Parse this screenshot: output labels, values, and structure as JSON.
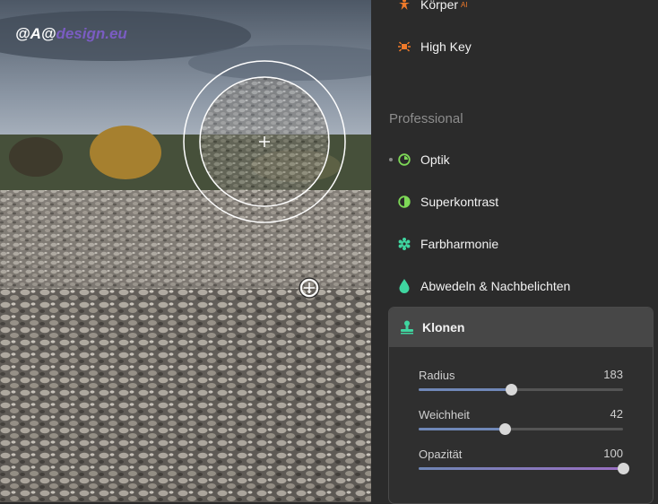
{
  "watermark": {
    "prefix": "@A@",
    "brand": "design.eu"
  },
  "tools_top": [
    {
      "label": "Körper",
      "badge": "AI",
      "icon": "body-icon",
      "color": "#f07a2a"
    },
    {
      "label": "High Key",
      "icon": "high-key-icon",
      "color": "#f07a2a"
    }
  ],
  "section": {
    "title": "Professional"
  },
  "tools_pro": [
    {
      "label": "Optik",
      "icon": "lens-icon",
      "color": "#7ed957"
    },
    {
      "label": "Superkontrast",
      "icon": "contrast-icon",
      "color": "#7ed957"
    },
    {
      "label": "Farbharmonie",
      "icon": "gear-flower-icon",
      "color": "#3fd6a0"
    },
    {
      "label": "Abwedeln & Nachbelichten",
      "icon": "drop-icon",
      "color": "#3fd6a0"
    }
  ],
  "klonen": {
    "title": "Klonen",
    "icon": "stamp-icon",
    "sliders": [
      {
        "label": "Radius",
        "value": "183",
        "fraction": 0.45
      },
      {
        "label": "Weichheit",
        "value": "42",
        "fraction": 0.42
      },
      {
        "label": "Opazität",
        "value": "100",
        "fraction": 1.0
      }
    ]
  }
}
